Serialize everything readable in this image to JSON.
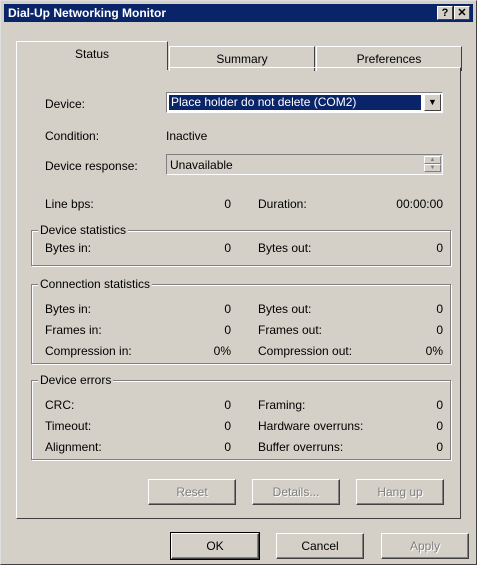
{
  "window": {
    "title": "Dial-Up Networking Monitor"
  },
  "titlebar_buttons": {
    "help": "?",
    "close": "✕"
  },
  "tabs": [
    "Status",
    "Summary",
    "Preferences"
  ],
  "status": {
    "device_label": "Device:",
    "device_value": "Place holder do not delete (COM2)",
    "condition_label": "Condition:",
    "condition_value": "Inactive",
    "device_response_label": "Device response:",
    "device_response_value": "Unavailable",
    "line_bps_label": "Line bps:",
    "line_bps_value": "0",
    "duration_label": "Duration:",
    "duration_value": "00:00:00"
  },
  "device_statistics": {
    "legend": "Device statistics",
    "bytes_in_label": "Bytes in:",
    "bytes_in": "0",
    "bytes_out_label": "Bytes out:",
    "bytes_out": "0"
  },
  "connection_statistics": {
    "legend": "Connection statistics",
    "bytes_in_label": "Bytes in:",
    "bytes_in": "0",
    "bytes_out_label": "Bytes out:",
    "bytes_out": "0",
    "frames_in_label": "Frames in:",
    "frames_in": "0",
    "frames_out_label": "Frames out:",
    "frames_out": "0",
    "compression_in_label": "Compression in:",
    "compression_in": "0%",
    "compression_out_label": "Compression out:",
    "compression_out": "0%"
  },
  "device_errors": {
    "legend": "Device errors",
    "crc_label": "CRC:",
    "crc": "0",
    "framing_label": "Framing:",
    "framing": "0",
    "timeout_label": "Timeout:",
    "timeout": "0",
    "hardware_overruns_label": "Hardware overruns:",
    "hardware_overruns": "0",
    "alignment_label": "Alignment:",
    "alignment": "0",
    "buffer_overruns_label": "Buffer overruns:",
    "buffer_overruns": "0"
  },
  "panel_buttons": {
    "reset": "Reset",
    "details": "Details...",
    "hang_up": "Hang up"
  },
  "dialog_buttons": {
    "ok": "OK",
    "cancel": "Cancel",
    "apply": "Apply"
  }
}
